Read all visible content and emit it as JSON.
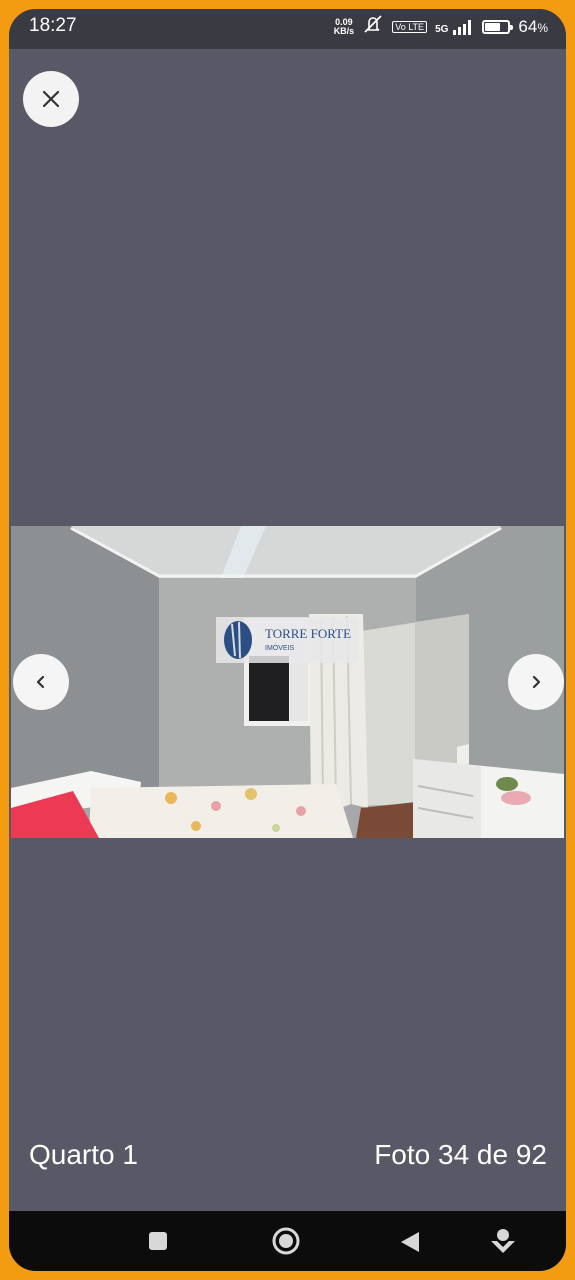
{
  "status_bar": {
    "time": "18:27",
    "net_speed_value": "0.09",
    "net_speed_unit": "KB/s",
    "volte_label": "Vo LTE",
    "network_label": "5G",
    "battery_percent": "64",
    "battery_suffix": "%",
    "battery_level": 0.64
  },
  "viewer": {
    "room_label": "Quarto 1",
    "photo_counter": "Foto 34 de 92",
    "watermark_brand": "TORRE FORTE",
    "watermark_sub": "IMÓVEIS",
    "current_photo": 34,
    "total_photos": 92
  },
  "icons": [
    "close-icon",
    "chevron-left-icon",
    "chevron-right-icon",
    "recents-square-icon",
    "home-circle-icon",
    "back-triangle-icon",
    "assistant-icon"
  ]
}
